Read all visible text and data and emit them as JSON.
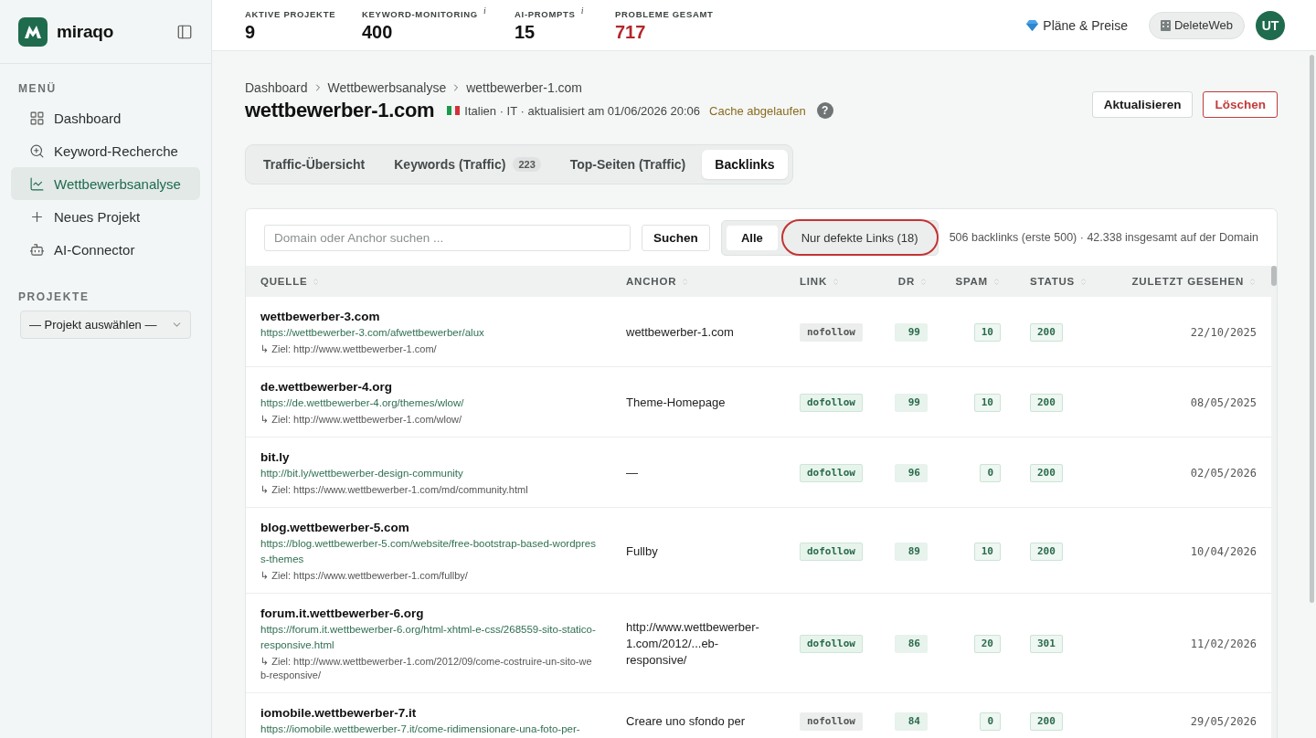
{
  "sidebar": {
    "logo_text": "miraqo",
    "menu_title": "MENÜ",
    "items": [
      {
        "label": "Dashboard",
        "selected": false
      },
      {
        "label": "Keyword-Recherche",
        "selected": false
      },
      {
        "label": "Wettbewerbsanalyse",
        "selected": true
      },
      {
        "label": "Neues Projekt",
        "selected": false
      },
      {
        "label": "AI-Connector",
        "selected": false
      }
    ],
    "projects_title": "PROJEKTE",
    "project_select": {
      "value": "— Projekt auswählen —"
    }
  },
  "topbar": {
    "stats": [
      {
        "label": "AKTIVE PROJEKTE",
        "value": "9",
        "alert": false
      },
      {
        "label": "KEYWORD-MONITORING",
        "hint": "i",
        "value": "400",
        "alert": false
      },
      {
        "label": "AI-PROMPTS",
        "hint": "i",
        "value": "15",
        "alert": false
      },
      {
        "label": "PROBLEME GESAMT",
        "value": "717",
        "alert": true
      }
    ],
    "plans_link": "Pläne & Preise",
    "account_button": "DeleteWeb",
    "avatar": "UT"
  },
  "header": {
    "breadcrumb": [
      "Dashboard",
      "Wettbewerbsanalyse",
      "wettbewerber-1.com"
    ],
    "title": "wettbewerber-1.com",
    "meta": "Italien · IT · aktualisiert am 01/06/2026 20:06",
    "cache_status": "Cache abgelaufen",
    "help": "?",
    "actions": [
      {
        "label": "Aktualisieren",
        "kind": "default"
      },
      {
        "label": "Löschen",
        "kind": "danger"
      }
    ]
  },
  "tabs": [
    {
      "label": "Traffic-Übersicht",
      "selected": false
    },
    {
      "label": "Keywords (Traffic)",
      "count": "223",
      "selected": false
    },
    {
      "label": "Top-Seiten (Traffic)",
      "selected": false
    },
    {
      "label": "Backlinks",
      "selected": true
    }
  ],
  "toolbar": {
    "search": {
      "placeholder": "Domain oder Anchor suchen ..."
    },
    "search_button": "Suchen",
    "filters": [
      {
        "label": "Alle",
        "selected": true,
        "highlighted": false
      },
      {
        "label": "Nur defekte Links (18)",
        "selected": false,
        "highlighted": true
      }
    ],
    "summary": "506 backlinks (erste 500) · 42.338 insgesamt auf der Domain"
  },
  "table": {
    "columns": [
      "QUELLE",
      "ANCHOR",
      "LINK",
      "DR",
      "SPAM",
      "STATUS",
      "ZULETZT GESEHEN"
    ],
    "rows": [
      {
        "domain": "wettbewerber-3.com",
        "url": "https://wettbewerber-3.com/afwettbewerber/alux",
        "target": "↳ Ziel: http://www.wettbewerber-1.com/",
        "anchor": "wettbewerber-1.com",
        "link": {
          "label": "nofollow",
          "followed": false
        },
        "dr": "99",
        "spam": "10",
        "status": "200",
        "last_seen": "22/10/2025"
      },
      {
        "domain": "de.wettbewerber-4.org",
        "url": "https://de.wettbewerber-4.org/themes/wlow/",
        "target": "↳ Ziel: http://www.wettbewerber-1.com/wlow/",
        "anchor": "Theme-Homepage",
        "link": {
          "label": "dofollow",
          "followed": true
        },
        "dr": "99",
        "spam": "10",
        "status": "200",
        "last_seen": "08/05/2025"
      },
      {
        "domain": "bit.ly",
        "url": "http://bit.ly/wettbewerber-design-community",
        "target": "↳ Ziel: https://www.wettbewerber-1.com/md/community.html",
        "anchor": "—",
        "link": {
          "label": "dofollow",
          "followed": true
        },
        "dr": "96",
        "spam": "0",
        "status": "200",
        "last_seen": "02/05/2026"
      },
      {
        "domain": "blog.wettbewerber-5.com",
        "url": "https://blog.wettbewerber-5.com/website/free-bootstrap-based-wordpress-themes",
        "target": "↳ Ziel: https://www.wettbewerber-1.com/fullby/",
        "anchor": "Fullby",
        "link": {
          "label": "dofollow",
          "followed": true
        },
        "dr": "89",
        "spam": "10",
        "status": "200",
        "last_seen": "10/04/2026"
      },
      {
        "domain": "forum.it.wettbewerber-6.org",
        "url": "https://forum.it.wettbewerber-6.org/html-xhtml-e-css/268559-sito-statico-responsive.html",
        "target": "↳ Ziel: http://www.wettbewerber-1.com/2012/09/come-costruire-un-sito-web-responsive/",
        "anchor": "http://www.wettbewerber-1.com/2012/...eb-responsive/",
        "link": {
          "label": "dofollow",
          "followed": true
        },
        "dr": "86",
        "spam": "20",
        "status": "301",
        "last_seen": "11/02/2026"
      },
      {
        "domain": "iomobile.wettbewerber-7.it",
        "url": "https://iomobile.wettbewerber-7.it/come-ridimensionare-una-foto-per-",
        "anchor": "Creare uno sfondo per",
        "link": {
          "label": "nofollow",
          "followed": false
        },
        "dr": "84",
        "spam": "0",
        "status": "200",
        "last_seen": "29/05/2026"
      }
    ]
  }
}
